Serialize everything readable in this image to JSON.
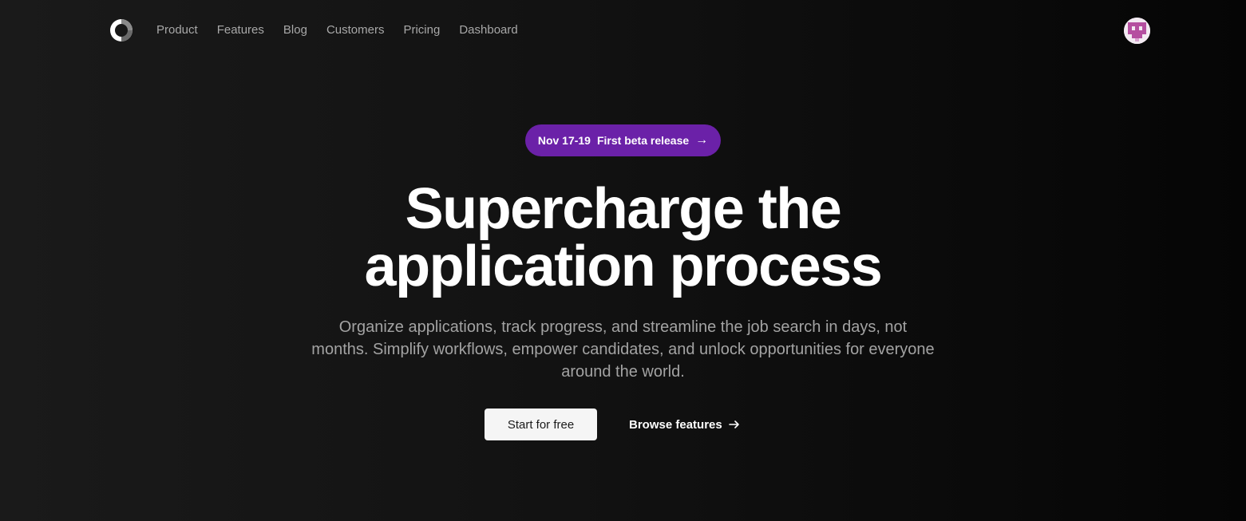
{
  "nav": {
    "logo_icon": "ring-logo-icon",
    "links": [
      "Product",
      "Features",
      "Blog",
      "Customers",
      "Pricing",
      "Dashboard"
    ],
    "avatar_icon": "pixel-avatar-icon"
  },
  "hero": {
    "badge": {
      "date": "Nov 17-19",
      "text": "First beta release",
      "arrow": "→",
      "color": "#6b21a8"
    },
    "headline_line1": "Supercharge the",
    "headline_line2": "application process",
    "subtext": "Organize applications, track progress, and streamline the job search in days, not months. Simplify workflows, empower candidates, and unlock opportunities for everyone around the world.",
    "primary_cta": "Start for free",
    "secondary_cta": "Browse features",
    "secondary_icon": "arrow-right-icon"
  },
  "colors": {
    "background": "#111111",
    "accent": "#6b21a8",
    "text_primary": "#ffffff",
    "text_muted": "#a3a3a3"
  }
}
